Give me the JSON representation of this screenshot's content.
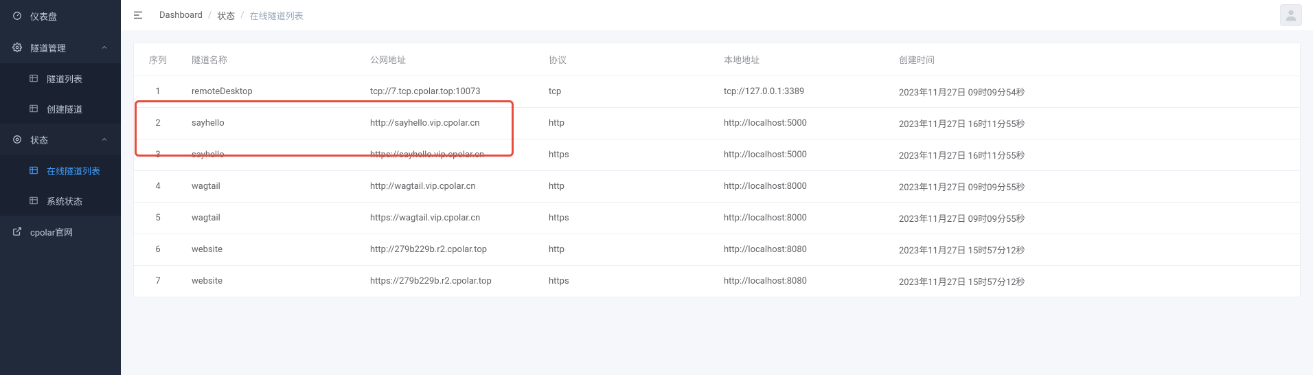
{
  "sidebar": {
    "dashboard": "仪表盘",
    "tunnel_mgmt": "隧道管理",
    "tunnel_list": "隧道列表",
    "create_tunnel": "创建隧道",
    "status": "状态",
    "online_tunnel_list": "在线隧道列表",
    "system_status": "系统状态",
    "official_site": "cpolar官网"
  },
  "breadcrumb": {
    "a": "Dashboard",
    "b": "状态",
    "c": "在线隧道列表"
  },
  "table": {
    "headers": {
      "seq": "序列",
      "name": "隧道名称",
      "url": "公网地址",
      "proto": "协议",
      "local": "本地地址",
      "created": "创建时间"
    },
    "rows": [
      {
        "seq": "1",
        "name": "remoteDesktop",
        "url": "tcp://7.tcp.cpolar.top:10073",
        "proto": "tcp",
        "local": "tcp://127.0.0.1:3389",
        "created": "2023年11月27日 09时09分54秒"
      },
      {
        "seq": "2",
        "name": "sayhello",
        "url": "http://sayhello.vip.cpolar.cn",
        "proto": "http",
        "local": "http://localhost:5000",
        "created": "2023年11月27日 16时11分55秒"
      },
      {
        "seq": "3",
        "name": "sayhello",
        "url": "https://sayhello.vip.cpolar.cn",
        "proto": "https",
        "local": "http://localhost:5000",
        "created": "2023年11月27日 16时11分55秒"
      },
      {
        "seq": "4",
        "name": "wagtail",
        "url": "http://wagtail.vip.cpolar.cn",
        "proto": "http",
        "local": "http://localhost:8000",
        "created": "2023年11月27日 09时09分55秒"
      },
      {
        "seq": "5",
        "name": "wagtail",
        "url": "https://wagtail.vip.cpolar.cn",
        "proto": "https",
        "local": "http://localhost:8000",
        "created": "2023年11月27日 09时09分55秒"
      },
      {
        "seq": "6",
        "name": "website",
        "url": "http://279b229b.r2.cpolar.top",
        "proto": "http",
        "local": "http://localhost:8080",
        "created": "2023年11月27日 15时57分12秒"
      },
      {
        "seq": "7",
        "name": "website",
        "url": "https://279b229b.r2.cpolar.top",
        "proto": "https",
        "local": "http://localhost:8080",
        "created": "2023年11月27日 15时57分12秒"
      }
    ]
  }
}
